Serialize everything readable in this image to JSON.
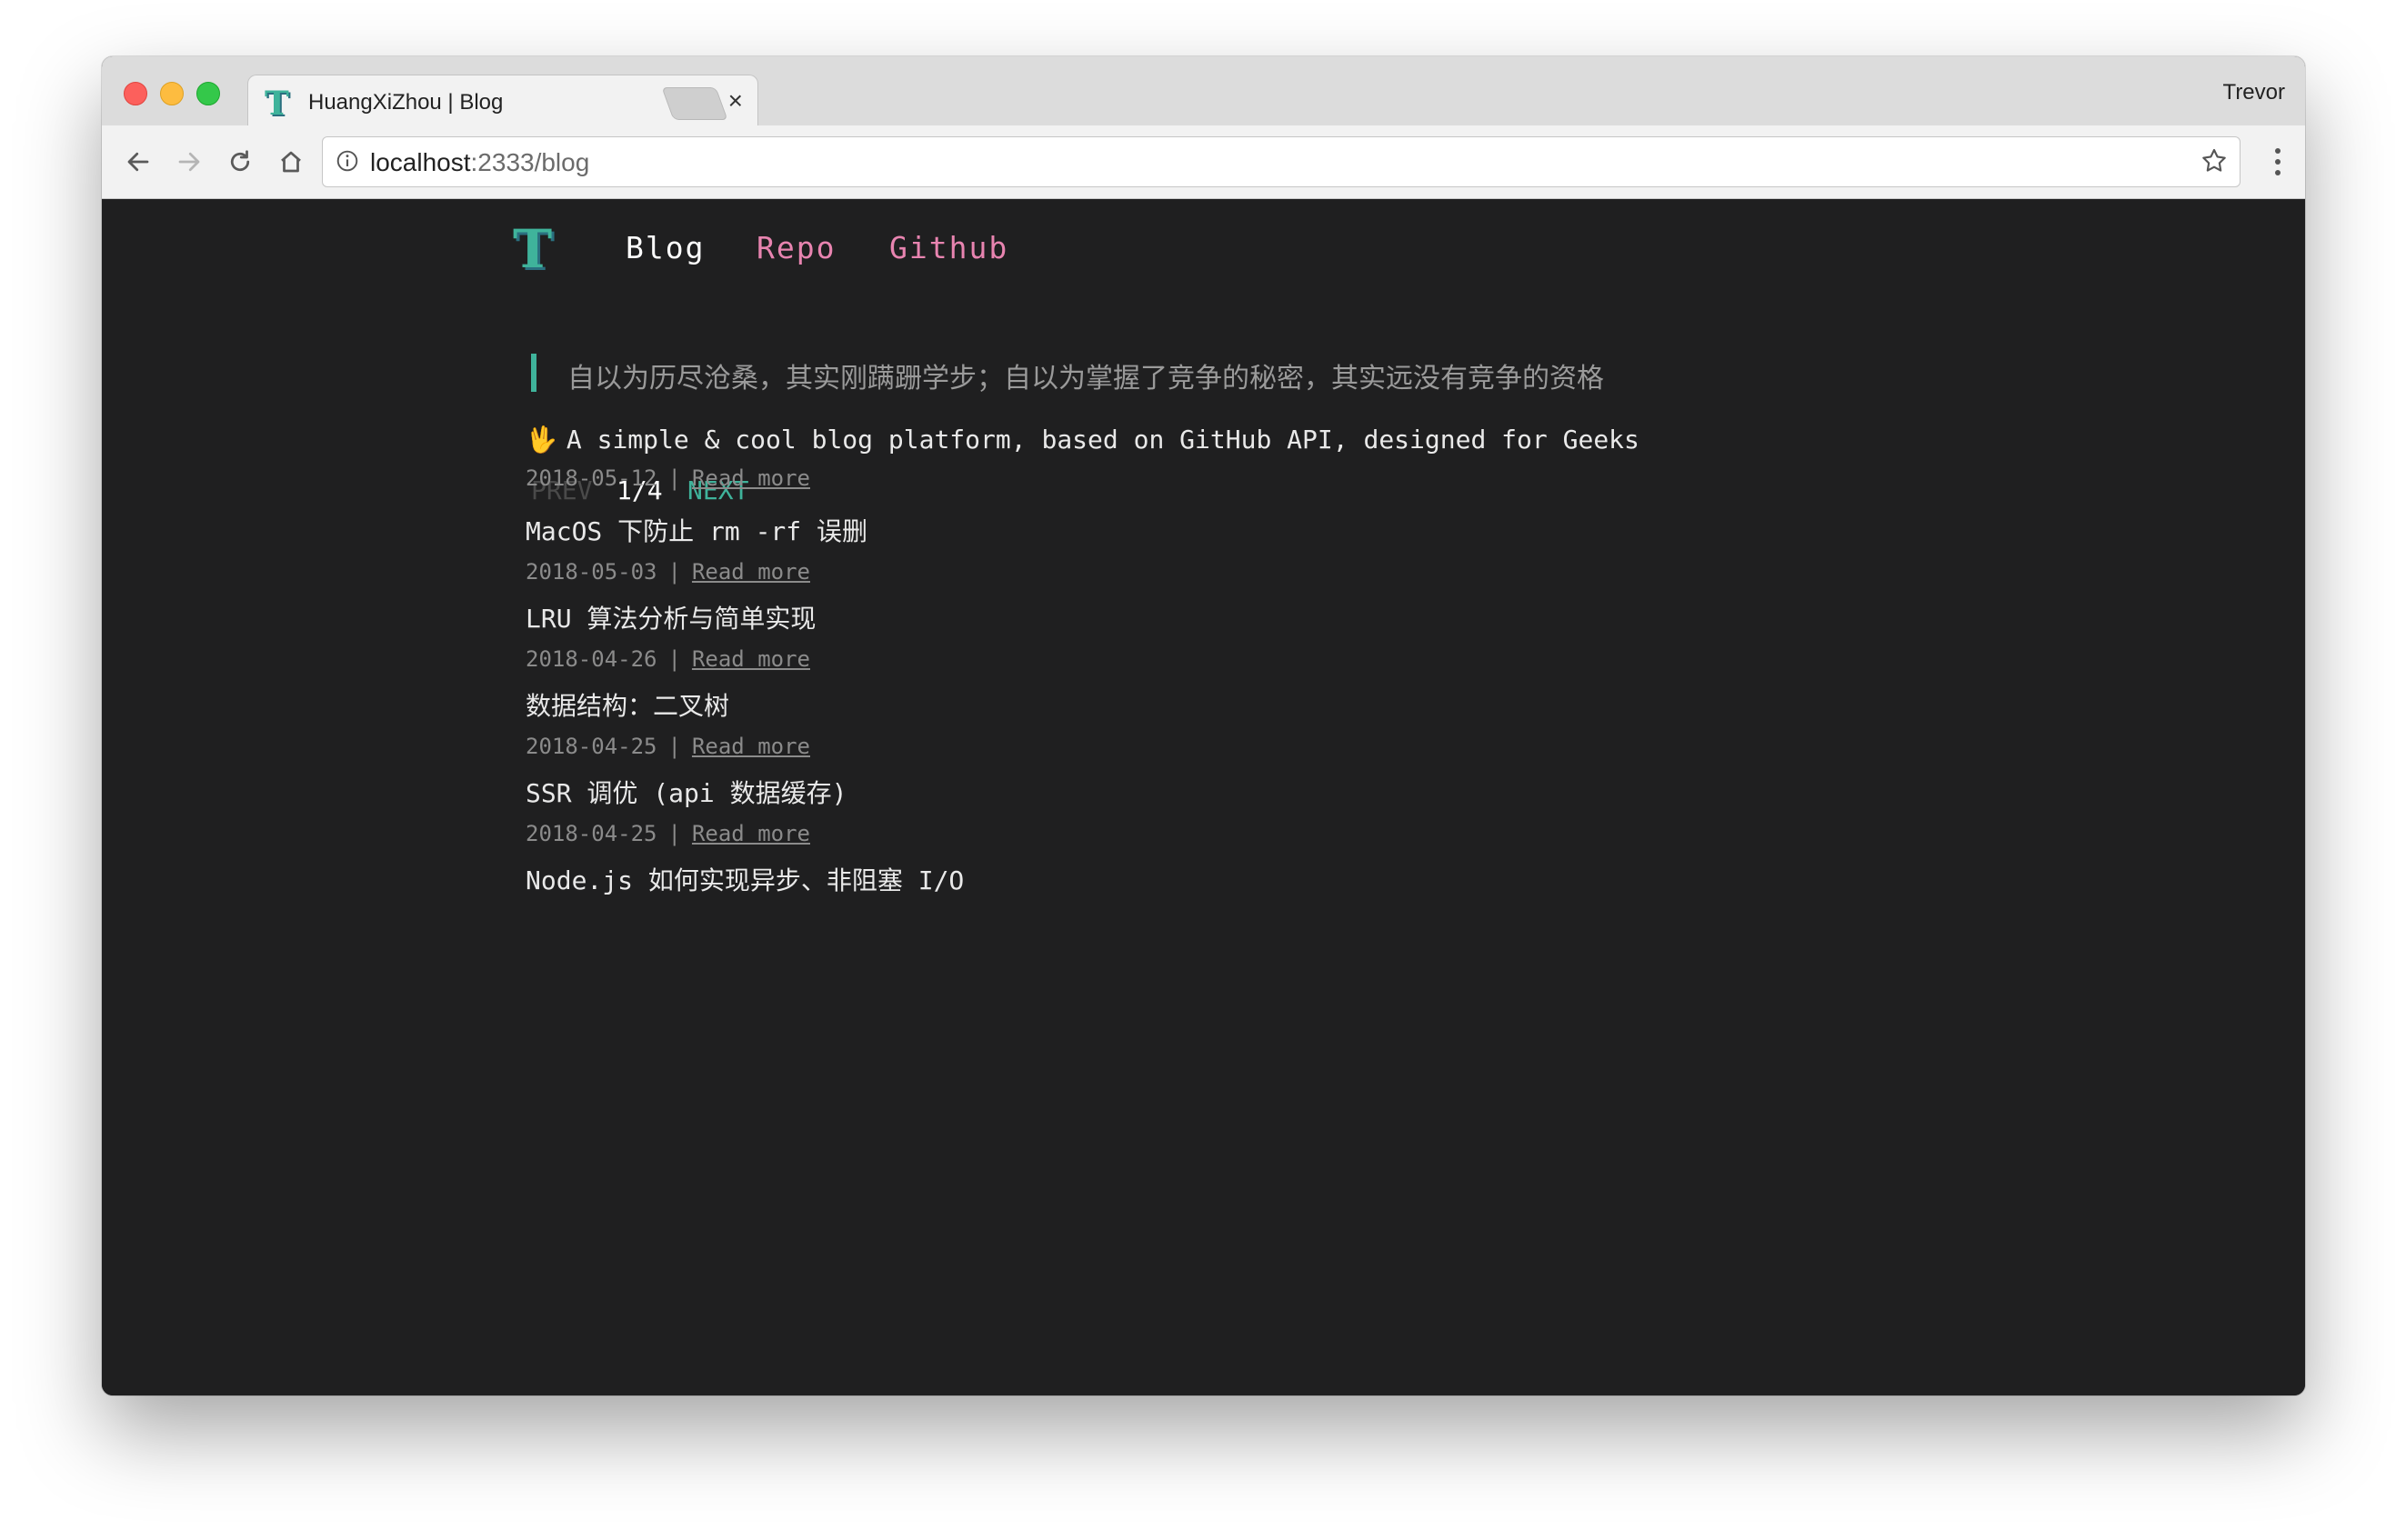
{
  "browser": {
    "tab": {
      "title": "HuangXiZhou | Blog",
      "close": "×"
    },
    "profile": "Trevor",
    "address": {
      "host": "localhost",
      "rest": ":2333/blog"
    }
  },
  "site": {
    "logo": "T",
    "nav": [
      {
        "label": "Blog"
      },
      {
        "label": "Repo"
      },
      {
        "label": "Github"
      }
    ],
    "quote": "自以为历尽沧桑，其实刚蹒跚学步；自以为掌握了竞争的秘密，其实远没有竞争的资格",
    "pager": {
      "prev": "PREV",
      "page": "1/4",
      "next": "NEXT"
    },
    "read_more": "Read more",
    "posts": [
      {
        "emoji": "🖖",
        "title": "A simple & cool blog platform, based on GitHub API, designed for Geeks",
        "date": "2018-05-12"
      },
      {
        "title": "MacOS 下防止 rm -rf 误删",
        "date": "2018-05-03"
      },
      {
        "title": "LRU 算法分析与简单实现",
        "date": "2018-04-26"
      },
      {
        "title": "数据结构：二叉树",
        "date": "2018-04-25"
      },
      {
        "title": "SSR 调优 (api 数据缓存)",
        "date": "2018-04-25"
      },
      {
        "title": "Node.js 如何实现异步、非阻塞 I/O"
      }
    ]
  },
  "colors": {
    "background": "#1f1f20",
    "accent_green": "#3fb39b",
    "accent_pink": "#e884b0"
  }
}
